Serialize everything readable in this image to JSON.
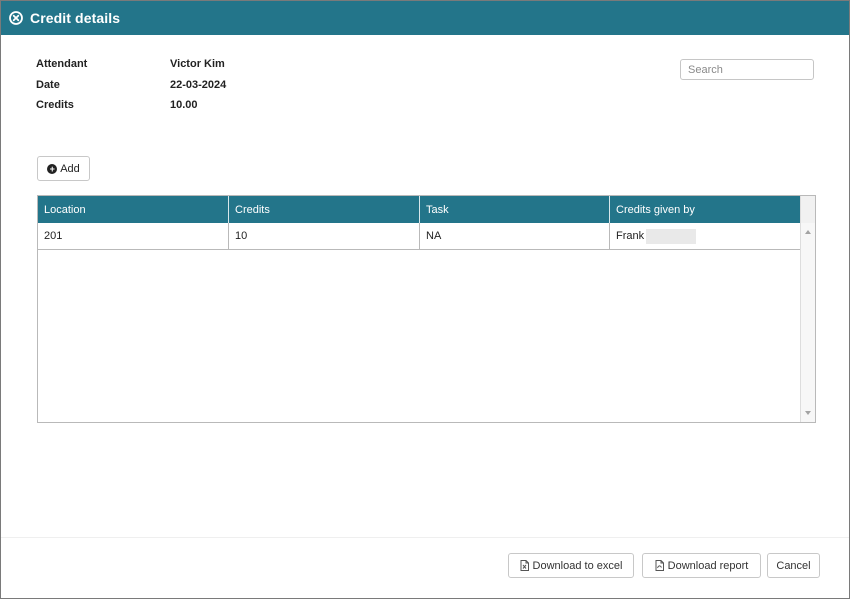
{
  "dialog": {
    "title": "Credit details"
  },
  "details": [
    {
      "label": "Attendant",
      "value": "Victor Kim"
    },
    {
      "label": "Date",
      "value": "22-03-2024"
    },
    {
      "label": "Credits",
      "value": "10.00"
    }
  ],
  "search": {
    "placeholder": "Search",
    "value": ""
  },
  "toolbar": {
    "add_label": "Add"
  },
  "table": {
    "columns": [
      "Location",
      "Credits",
      "Task",
      "Credits given by"
    ],
    "rows": [
      [
        "201",
        "10",
        "NA",
        "Frank"
      ]
    ]
  },
  "footer": {
    "download_excel_label": "Download to excel",
    "download_report_label": "Download report",
    "cancel_label": "Cancel"
  },
  "colors": {
    "header_teal": "#23758a",
    "border_gray": "#b9b9b9"
  },
  "icons": {
    "close": "close-circle-icon",
    "add": "plus-circle-icon",
    "excel": "excel-file-icon",
    "pdf": "pdf-file-icon"
  }
}
